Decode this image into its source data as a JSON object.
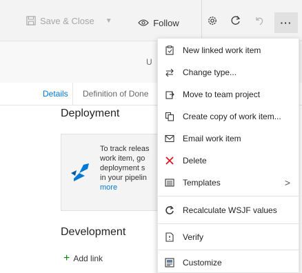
{
  "toolbar": {
    "save_label": "Save & Close",
    "follow_label": "Follow"
  },
  "header": {
    "partial_text": "U"
  },
  "tabs": [
    {
      "label": "Details"
    },
    {
      "label": "Definition of Done"
    }
  ],
  "deployment": {
    "title": "Deployment",
    "text": "To track releas\nwork item, go\ndeployment s\nin your pipelin",
    "more_link": "more"
  },
  "development": {
    "title": "Development",
    "add_link_label": "Add link"
  },
  "menu": {
    "items": [
      {
        "label": "New linked work item",
        "icon": "clipboard-link-icon"
      },
      {
        "label": "Change type...",
        "icon": "change-type-icon"
      },
      {
        "label": "Move to team project",
        "icon": "move-icon"
      },
      {
        "label": "Create copy of work item...",
        "icon": "copy-icon"
      },
      {
        "label": "Email work item",
        "icon": "mail-icon"
      },
      {
        "label": "Delete",
        "icon": "delete-icon",
        "color": "#e81123"
      },
      {
        "label": "Templates",
        "icon": "templates-icon"
      },
      {
        "label": "Recalculate WSJF values",
        "icon": "recalculate-icon"
      },
      {
        "label": "Verify",
        "icon": "verify-icon"
      },
      {
        "label": "Customize",
        "icon": "customize-icon"
      }
    ]
  },
  "colors": {
    "accent": "#0078d4",
    "delete": "#e81123",
    "add": "#107c10"
  }
}
